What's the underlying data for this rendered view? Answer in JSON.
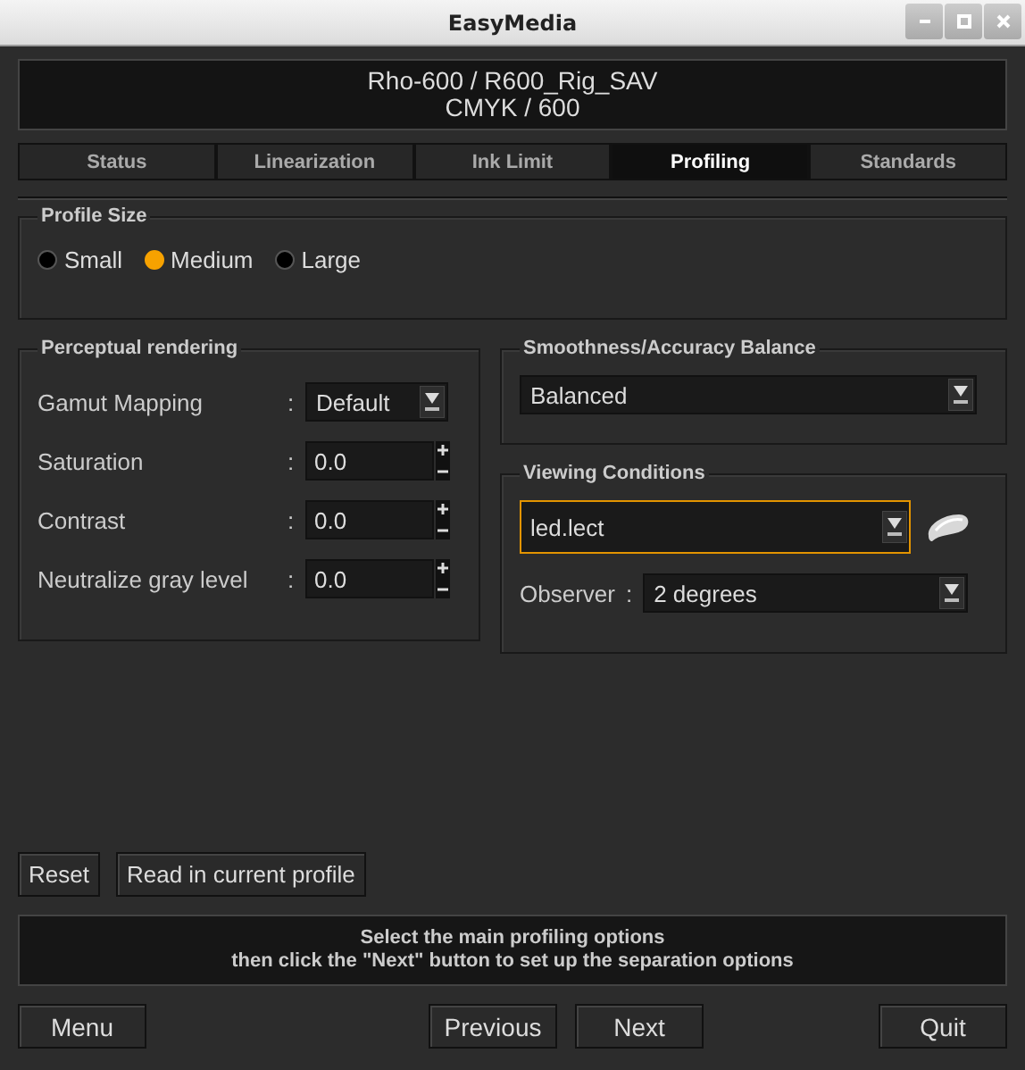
{
  "window": {
    "title": "EasyMedia"
  },
  "header": {
    "lines": [
      "Rho-600 / R600_Rig_SAV",
      "CMYK / 600"
    ]
  },
  "tabs": [
    {
      "label": "Status",
      "selected": false
    },
    {
      "label": "Linearization",
      "selected": false
    },
    {
      "label": "Ink Limit",
      "selected": false
    },
    {
      "label": "Profiling",
      "selected": true
    },
    {
      "label": "Standards",
      "selected": false
    }
  ],
  "profile_size": {
    "title": "Profile Size",
    "options": [
      {
        "label": "Small",
        "selected": false
      },
      {
        "label": "Medium",
        "selected": true
      },
      {
        "label": "Large",
        "selected": false
      }
    ]
  },
  "perceptual": {
    "title": "Perceptual rendering",
    "fields": [
      {
        "kind": "dropdown",
        "label": "Gamut Mapping",
        "separator": ":",
        "value": "Default"
      },
      {
        "kind": "spinner",
        "label": "Saturation",
        "separator": ":",
        "value": "0.0"
      },
      {
        "kind": "spinner",
        "label": "Contrast",
        "separator": ":",
        "value": "0.0"
      },
      {
        "kind": "spinner",
        "label": "Neutralize gray level",
        "separator": ":",
        "value": "0.0"
      }
    ]
  },
  "smoothness": {
    "title": "Smoothness/Accuracy Balance",
    "value": "Balanced"
  },
  "viewing": {
    "title": "Viewing Conditions",
    "value": "led.lect",
    "focused": true,
    "observer": {
      "label": "Observer",
      "separator": ":",
      "value": "2 degrees"
    }
  },
  "actions": [
    "Reset",
    "Read in current profile"
  ],
  "message": [
    "Select the main profiling options",
    "then click the \"Next\" button to set up the separation options"
  ],
  "nav": {
    "left": [
      "Menu"
    ],
    "center": [
      "Previous",
      "Next"
    ],
    "right": [
      "Quit"
    ]
  }
}
